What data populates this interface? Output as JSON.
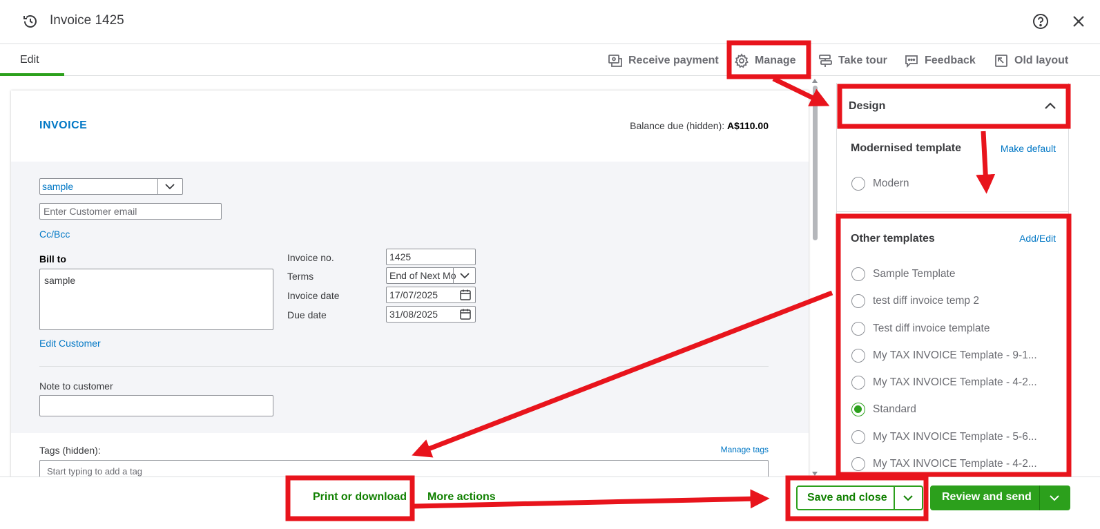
{
  "header": {
    "title": "Invoice 1425",
    "help_icon": "help-circle-icon",
    "close_icon": "close-icon",
    "history_icon": "history-icon"
  },
  "tabs": [
    {
      "label": "Edit",
      "active": true
    }
  ],
  "actions": {
    "receive_payment": "Receive payment",
    "manage": "Manage",
    "take_tour": "Take tour",
    "feedback": "Feedback",
    "old_layout": "Old layout"
  },
  "invoice": {
    "heading": "INVOICE",
    "balance_label": "Balance due (hidden):",
    "balance_value": "A$110.00",
    "customer": "sample",
    "email_placeholder": "Enter Customer email",
    "cc_bcc": "Cc/Bcc",
    "bill_to_label": "Bill to",
    "bill_to_value": "sample",
    "edit_customer": "Edit Customer",
    "fields": {
      "invoice_no_label": "Invoice no.",
      "invoice_no": "1425",
      "terms_label": "Terms",
      "terms": "End of Next Mo",
      "invoice_date_label": "Invoice date",
      "invoice_date": "17/07/2025",
      "due_date_label": "Due date",
      "due_date": "31/08/2025"
    },
    "note_label": "Note to customer",
    "tags_label": "Tags (hidden):",
    "manage_tags": "Manage tags",
    "tags_placeholder": "Start typing to add a tag"
  },
  "design_panel": {
    "title": "Design",
    "modern_section": "Modernised template",
    "make_default": "Make default",
    "modern_templates": [
      {
        "label": "Modern",
        "selected": false
      }
    ],
    "other_section": "Other templates",
    "add_edit": "Add/Edit",
    "other_templates": [
      {
        "label": "Sample Template",
        "selected": false
      },
      {
        "label": "test diff invoice temp 2",
        "selected": false
      },
      {
        "label": "Test diff invoice template",
        "selected": false
      },
      {
        "label": "My TAX INVOICE Template - 9-1...",
        "selected": false
      },
      {
        "label": "My TAX INVOICE Template - 4-2...",
        "selected": false
      },
      {
        "label": "Standard",
        "selected": true
      },
      {
        "label": "My TAX INVOICE Template - 5-6...",
        "selected": false
      },
      {
        "label": "My TAX INVOICE Template - 4-2...",
        "selected": false
      }
    ]
  },
  "footer": {
    "print_or_download": "Print or download",
    "more_actions": "More actions",
    "save_and_close": "Save and close",
    "review_and_send": "Review and send"
  },
  "colors": {
    "accent_green": "#2ca01c",
    "link_blue": "#0077c5",
    "annotation_red": "#e8141c"
  }
}
